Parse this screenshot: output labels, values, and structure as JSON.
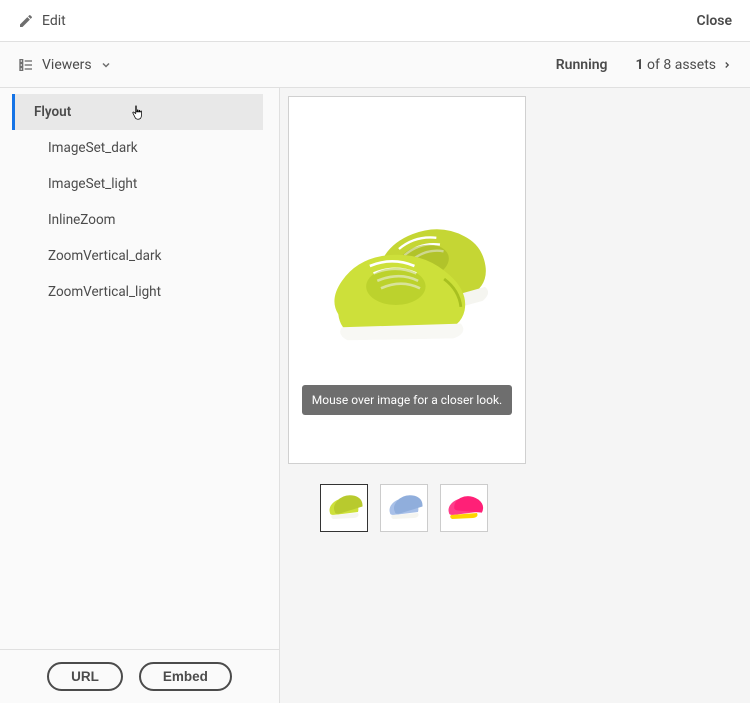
{
  "topBar": {
    "editLabel": "Edit",
    "closeLabel": "Close"
  },
  "subBar": {
    "viewersLabel": "Viewers",
    "runningLabel": "Running",
    "assetCountCurrent": "1",
    "assetCountOf": " of 8 assets"
  },
  "sidebar": {
    "items": [
      {
        "label": "Flyout",
        "selected": true
      },
      {
        "label": "ImageSet_dark",
        "selected": false
      },
      {
        "label": "ImageSet_light",
        "selected": false
      },
      {
        "label": "InlineZoom",
        "selected": false
      },
      {
        "label": "ZoomVertical_dark",
        "selected": false
      },
      {
        "label": "ZoomVertical_light",
        "selected": false
      }
    ],
    "urlButton": "URL",
    "embedButton": "Embed"
  },
  "preview": {
    "tipText": "Mouse over image for a closer look.",
    "thumbnails": [
      {
        "color": "lime",
        "selected": true
      },
      {
        "color": "lightblue",
        "selected": false
      },
      {
        "color": "pink",
        "selected": false
      }
    ]
  }
}
